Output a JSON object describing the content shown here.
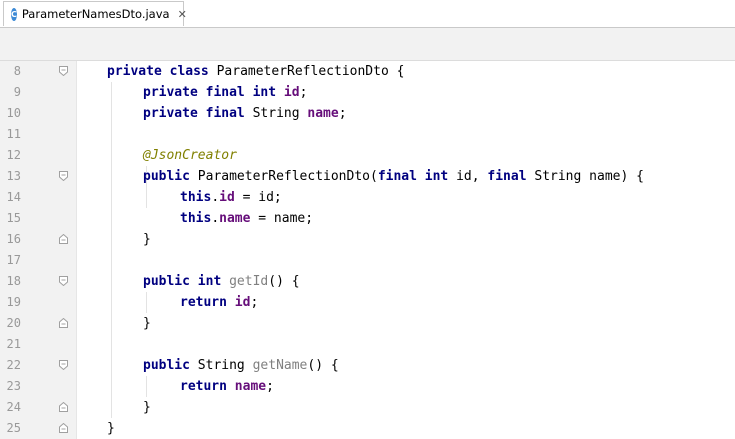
{
  "tab": {
    "icon_letter": "C",
    "file_name": "ParameterNamesDto.java",
    "close_glyph": "✕"
  },
  "editor": {
    "lines": [
      {
        "num": "8",
        "fold": "open"
      },
      {
        "num": "9"
      },
      {
        "num": "10"
      },
      {
        "num": "11"
      },
      {
        "num": "12"
      },
      {
        "num": "13",
        "fold": "open"
      },
      {
        "num": "14"
      },
      {
        "num": "15"
      },
      {
        "num": "16",
        "fold": "close"
      },
      {
        "num": "17"
      },
      {
        "num": "18",
        "fold": "open"
      },
      {
        "num": "19"
      },
      {
        "num": "20",
        "fold": "close"
      },
      {
        "num": "21"
      },
      {
        "num": "22",
        "fold": "open"
      },
      {
        "num": "23"
      },
      {
        "num": "24",
        "fold": "close"
      },
      {
        "num": "25",
        "fold": "close"
      }
    ],
    "tokens": {
      "l8": [
        "private",
        "class",
        "ParameterReflectionDto {"
      ],
      "l9": [
        "private",
        "final",
        "int",
        "id",
        ";"
      ],
      "l10": [
        "private",
        "final",
        "String ",
        "name",
        ";"
      ],
      "l12": [
        "@JsonCreator"
      ],
      "l13": [
        "public",
        "ParameterReflectionDto(",
        "final",
        "int",
        "id, ",
        "final",
        "String name) {"
      ],
      "l14": [
        "this",
        ".",
        "id",
        " = id;"
      ],
      "l15": [
        "this",
        ".",
        "name",
        " = name;"
      ],
      "l16": [
        "}"
      ],
      "l18": [
        "public",
        "int",
        "getId",
        "() {"
      ],
      "l19": [
        "return",
        "id",
        ";"
      ],
      "l20": [
        "}"
      ],
      "l22": [
        "public",
        "String ",
        "getName",
        "() {"
      ],
      "l23": [
        "return",
        "name",
        ";"
      ],
      "l24": [
        "}"
      ],
      "l25": [
        "}"
      ]
    }
  },
  "colors": {
    "keyword": "#000080",
    "field": "#660e7a",
    "annotation": "#808000",
    "unused_method": "#808080",
    "line_number": "#999999",
    "gutter_bg": "#f2f2f2",
    "tab_icon": "#3d8ad6"
  }
}
